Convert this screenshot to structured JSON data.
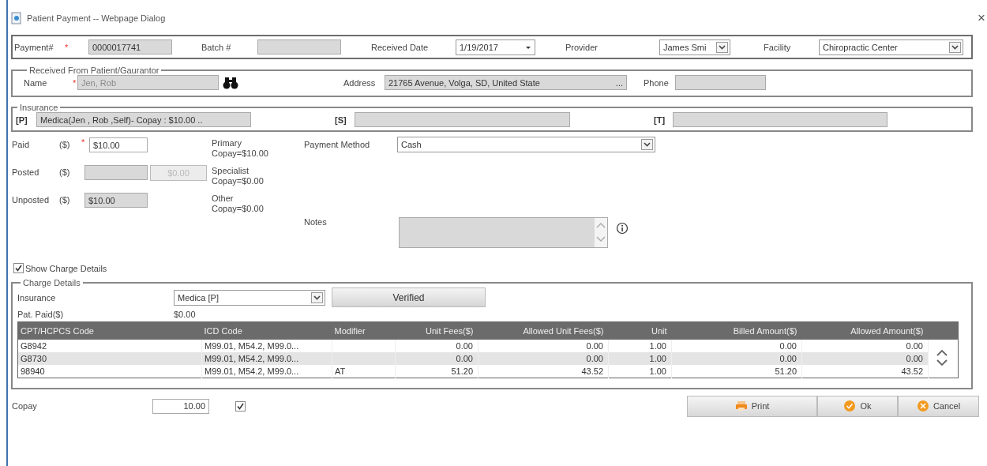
{
  "window": {
    "title": "Patient Payment -- Webpage Dialog",
    "close": "×"
  },
  "header": [
    {
      "label": "Payment#",
      "required_marker": "*",
      "kind": "text",
      "value": "0000017741",
      "readonly": true
    },
    {
      "label": "Batch #",
      "kind": "text",
      "readonly": true
    },
    {
      "label": "Received Date",
      "kind": "date",
      "value": "1/19/2017"
    },
    {
      "label": "Provider",
      "kind": "select",
      "value": "James Smi"
    },
    {
      "label": "Facility",
      "kind": "select",
      "value": "Chiropractic Center"
    }
  ],
  "received_from": {
    "legend": "Received From Patient/Gaurantor",
    "name": {
      "label": "Name",
      "required_marker": "*",
      "placeholder": "Jen, Rob",
      "readonly": true
    },
    "address": {
      "label": "Address",
      "value": "21765 Avenue, Volga, SD, United State",
      "more": "...",
      "readonly": true
    },
    "phone": {
      "label": "Phone",
      "readonly": true
    }
  },
  "insurance": {
    "legend": "Insurance",
    "plans": [
      {
        "tag": "[P]",
        "value": "Medica(Jen , Rob ,Self)- Copay : $10.00 ..",
        "readonly": true
      },
      {
        "tag": "[S]",
        "readonly": true
      },
      {
        "tag": "[T]",
        "readonly": true
      }
    ]
  },
  "amounts": [
    {
      "label": "Paid",
      "unit": "($)",
      "required_marker": "*",
      "value": "$10.00",
      "readonly": false
    },
    {
      "label": "Posted",
      "unit": "($)",
      "readonly": true,
      "button": {
        "label": "$0.00",
        "disabled": true
      }
    },
    {
      "label": "Unposted",
      "unit": "($)",
      "value": "$10.00",
      "readonly": true
    }
  ],
  "copays": [
    {
      "label": "Primary",
      "value": "Copay=$10.00"
    },
    {
      "label": "Specialist",
      "value": "Copay=$0.00"
    },
    {
      "label": "Other",
      "value": "Copay=$0.00"
    }
  ],
  "payment_method": {
    "label": "Payment Method",
    "value": "Cash"
  },
  "notes": {
    "label": "Notes",
    "readonly": true
  },
  "show_charge_details": {
    "label": "Show Charge Details",
    "checked": true
  },
  "charge_details": {
    "legend": "Charge Details",
    "insurance": {
      "label": "Insurance",
      "value": "Medica [P]"
    },
    "verify_button": {
      "label": "Verified"
    },
    "pat_paid": {
      "label": "Pat. Paid($)",
      "value": "$0.00"
    },
    "table": {
      "columns": [
        {
          "label": "CPT/HCPCS Code",
          "kind": "text"
        },
        {
          "label": "ICD Code",
          "kind": "text"
        },
        {
          "label": "Modifier",
          "kind": "text"
        },
        {
          "label": "Unit Fees($)",
          "kind": "number"
        },
        {
          "label": "Allowed Unit Fees($)",
          "kind": "number"
        },
        {
          "label": "Unit",
          "kind": "number"
        },
        {
          "label": "Billed Amount($)",
          "kind": "number"
        },
        {
          "label": "Allowed Amount($)",
          "kind": "number"
        }
      ],
      "rows": [
        [
          "G8942",
          "M99.01, M54.2, M99.0...",
          null,
          "0.00",
          "0.00",
          "1.00",
          "0.00",
          "0.00"
        ],
        [
          "G8730",
          "M99.01, M54.2, M99.0...",
          null,
          "0.00",
          "0.00",
          "1.00",
          "0.00",
          "0.00"
        ],
        [
          "98940",
          "M99.01, M54.2, M99.0...",
          "AT",
          "51.20",
          "43.52",
          "1.00",
          "51.20",
          "43.52"
        ]
      ]
    }
  },
  "copay": {
    "label": "Copay",
    "value": "10.00",
    "checked": true
  },
  "buttons": [
    {
      "kind": "print",
      "label": "Print"
    },
    {
      "kind": "ok",
      "label": "Ok"
    },
    {
      "kind": "cancel",
      "label": "Cancel"
    }
  ]
}
